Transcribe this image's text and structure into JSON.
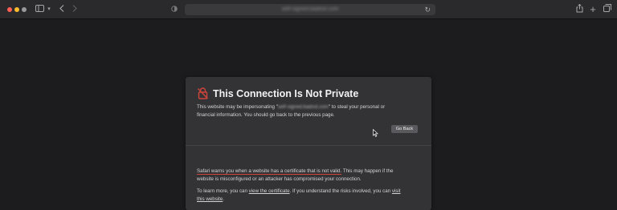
{
  "window": {
    "traffic_lights": [
      "#ff5f57",
      "#febc2e",
      "#9a9a9c"
    ]
  },
  "toolbar": {
    "address_text": "self-signed.badssl.com"
  },
  "warning": {
    "title": "This Connection Is Not Private",
    "line1_before": "This website may be impersonating \"",
    "domain": "self-signed.badssl.com",
    "line1_after": "\" to steal your personal or",
    "line2": "financial information. You should go back to the previous page.",
    "go_back_label": "Go Back",
    "para1_highlight": "Safari warns you when a website has a certificate that is not valid.",
    "para1_rest_a": " This may happen if the",
    "para1_line2": "website is misconfigured or an attacker has compromised your connection.",
    "para2_before": "To learn more, you can ",
    "para2_link1": "view the certificate",
    "para2_middle": ". If you understand the risks involved, you can ",
    "para2_link2a": "visit",
    "para2_link2b": "this website",
    "para2_end": "."
  },
  "colors": {
    "lock_icon": "#d0453a",
    "highlight_underline": "#d0453a"
  }
}
